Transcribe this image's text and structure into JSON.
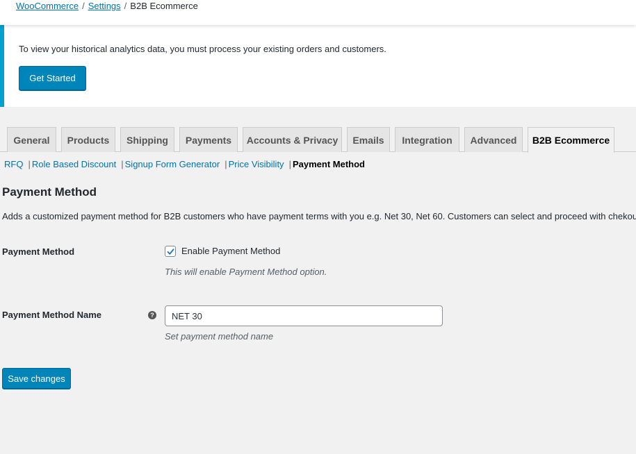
{
  "breadcrumb": {
    "items": [
      "WooCommerce",
      "Settings"
    ],
    "separator": "/",
    "current": "B2B Ecommerce"
  },
  "notice": {
    "text": "To view your historical analytics data, you must process your existing orders and customers.",
    "button_label": "Get Started",
    "accent_color": "#00a0d2"
  },
  "tabs": [
    {
      "label": "General",
      "active": false
    },
    {
      "label": "Products",
      "active": false
    },
    {
      "label": "Shipping",
      "active": false
    },
    {
      "label": "Payments",
      "active": false
    },
    {
      "label": "Accounts & Privacy",
      "active": false
    },
    {
      "label": "Emails",
      "active": false
    },
    {
      "label": "Integration",
      "active": false
    },
    {
      "label": "Advanced",
      "active": false
    },
    {
      "label": "B2B Ecommerce",
      "active": true
    }
  ],
  "subnav": {
    "links": [
      "RFQ",
      "Role Based Discount",
      "Signup Form Generator",
      "Price Visibility"
    ],
    "separator": "|",
    "current": "Payment Method"
  },
  "section": {
    "title": "Payment Method",
    "description": "Adds a customized payment method for B2B customers who have payment terms with you e.g. Net 30, Net 60. Customers can select and proceed with chekout"
  },
  "fields": {
    "enable": {
      "label": "Payment Method",
      "checkbox_label": "Enable Payment Method",
      "checked": true,
      "help": "This will enable Payment Method option."
    },
    "name": {
      "label": "Payment Method Name",
      "help_icon": "question-circle-icon",
      "value": "NET 30",
      "help": "Set payment method name"
    }
  },
  "save_label": "Save changes",
  "colors": {
    "primary_button": "#0085ba",
    "link": "#0073aa"
  }
}
